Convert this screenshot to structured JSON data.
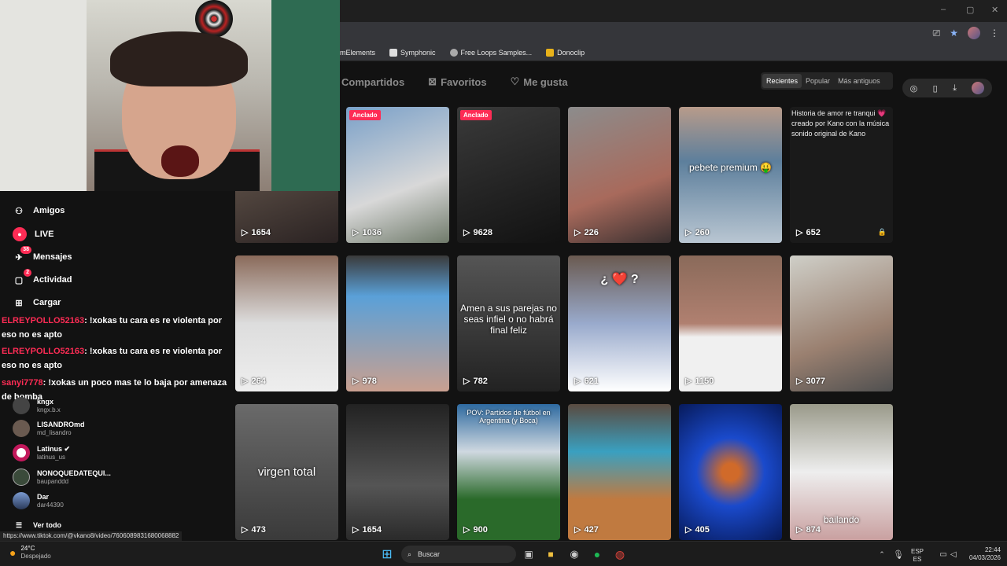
{
  "browser": {
    "window_controls": [
      "–",
      "▢",
      "✕"
    ],
    "bookmarks": [
      {
        "label": "mElements",
        "color": "#777"
      },
      {
        "label": "Symphonic",
        "color": "#ddd"
      },
      {
        "label": "Free Loops Samples...",
        "color": "#aaa"
      },
      {
        "label": "Donoclip",
        "color": "#e8b21a"
      }
    ],
    "status_url": "https://www.tiktok.com/@vkano8/video/7606089831680068882"
  },
  "profile_tabs": [
    {
      "label": "Compartidos",
      "icon": "share-icon"
    },
    {
      "label": "Favoritos",
      "icon": "bookmark-icon"
    },
    {
      "label": "Me gusta",
      "icon": "heart-icon"
    }
  ],
  "sort": {
    "options": [
      "Recientes",
      "Popular",
      "Más antiguos"
    ],
    "selected": "Recientes"
  },
  "videos": [
    {
      "views": "1654",
      "pinned": false,
      "overlay": "",
      "bg": "linear-gradient(160deg,#7a6a5c,#2a2222)"
    },
    {
      "views": "1036",
      "pinned": true,
      "pin_label": "Anclado",
      "overlay": "",
      "bg": "linear-gradient(160deg,#7aa0c8,#d8d8d8 60%,#6f7a6a)"
    },
    {
      "views": "9628",
      "pinned": true,
      "pin_label": "Anclado",
      "overlay": "",
      "bg": "linear-gradient(160deg,#3a3a3a,#121212)"
    },
    {
      "views": "226",
      "pinned": false,
      "overlay": "",
      "bg": "linear-gradient(160deg,#8c8c8c,#a86a5c 60%,#3a3030)"
    },
    {
      "views": "260",
      "pinned": false,
      "overlay": "pebete premium 🤑",
      "bg": "linear-gradient(180deg,#b89b8a 0%,#5d7f9c 40%,#b9c6d2 100%)"
    },
    {
      "views": "652",
      "pinned": false,
      "overlay": "",
      "locked": true,
      "text_card": "Historia de amor re tranqui 💗 creado por Kano con la música sonido original de Kano",
      "bg": "#1a1a1a"
    },
    {
      "views": "264",
      "pinned": false,
      "overlay": "",
      "bg": "linear-gradient(180deg,#8a6a5a 0%,#ddd 50%,#eee 100%)"
    },
    {
      "views": "978",
      "pinned": false,
      "overlay": "",
      "bg": "linear-gradient(180deg,#3a3a3a 0%,#5aa0d8 30%,#c9a090 100%)"
    },
    {
      "views": "782",
      "pinned": false,
      "overlay": "Amen a sus parejas no seas infiel o no habrá final feliz",
      "bg": "linear-gradient(180deg,#555,#222)"
    },
    {
      "views": "621",
      "pinned": false,
      "overlay": "¿ ❤️ ?",
      "bg": "linear-gradient(180deg,#6a5a50 0%,#9ac 50%,#fff 100%)"
    },
    {
      "views": "1150",
      "pinned": false,
      "overlay": "",
      "bg": "linear-gradient(180deg,#8a6a5a 0%,#b08070 50%,#f0f0f0 60%)"
    },
    {
      "views": "3077",
      "pinned": false,
      "overlay": "",
      "bg": "linear-gradient(160deg,#cfcfc8,#9a8070 60%,#505050)"
    },
    {
      "views": "473",
      "pinned": false,
      "overlay": "virgen total",
      "bg": "linear-gradient(180deg,#6a6a6a,#3a3a3a)"
    },
    {
      "views": "1654",
      "pinned": false,
      "overlay": "",
      "bg": "linear-gradient(180deg,#222,#555 60%,#2a2a2a)"
    },
    {
      "views": "900",
      "pinned": false,
      "overlay": "POV: Partidos de fútbol en Argentina (y Boca)",
      "bg": "linear-gradient(180deg,#2e6aa0 0%,#cfd8e0 35%,#2a6a2a 70%)"
    },
    {
      "views": "427",
      "pinned": false,
      "overlay": "",
      "bg": "linear-gradient(180deg,#5a4a40 0%,#3aa0c0 35%,#c07a40 70%)"
    },
    {
      "views": "405",
      "pinned": false,
      "overlay": "",
      "bg": "radial-gradient(circle,#d06a2a 10%,#1a4acc 40%,#071a5a 100%)"
    },
    {
      "views": "874",
      "pinned": false,
      "overlay": "bailando",
      "bg": "linear-gradient(180deg,#9a9a8a 0%,#eee 50%,#c9a0a0 100%)"
    }
  ],
  "nav": [
    {
      "label": "Amigos",
      "icon": "friends-icon",
      "badge": ""
    },
    {
      "label": "LIVE",
      "icon": "live-icon",
      "badge": ""
    },
    {
      "label": "Mensajes",
      "icon": "messages-icon",
      "badge": "38"
    },
    {
      "label": "Actividad",
      "icon": "activity-icon",
      "badge": "2"
    },
    {
      "label": "Cargar",
      "icon": "upload-icon",
      "badge": ""
    }
  ],
  "chat": [
    {
      "user": "ELREYPOLLO52163",
      "text": ": !xokas tu cara es re violenta por eso no es apto"
    },
    {
      "user": "ELREYPOLLO52163",
      "text": ": !xokas tu cara es re violenta por eso no es apto"
    },
    {
      "user": "sanyi7778",
      "text": ": !xokas un poco mas te lo baja por amenaza de bomba"
    }
  ],
  "following": [
    {
      "name": "kngx",
      "handle": "kngx.b.x",
      "color": "#444"
    },
    {
      "name": "LISANDROmd",
      "handle": "md_lisandro",
      "color": "#6a5a50"
    },
    {
      "name": "Latinus ✔",
      "handle": "latinus_us",
      "color": "#e8e8e8"
    },
    {
      "name": "NONOQUEDATEQUI...",
      "handle": "baupanddd",
      "color": "#3a4a3a"
    },
    {
      "name": "Dar",
      "handle": "dar44390",
      "color": "#4a6aa0"
    }
  ],
  "see_all": "Ver todo",
  "taskbar": {
    "weather_temp": "24°C",
    "weather_text": "Despejado",
    "search_label": "Buscar",
    "lang_top": "ESP",
    "lang_bottom": "ES",
    "time": "22:44",
    "date": "04/03/2026"
  }
}
